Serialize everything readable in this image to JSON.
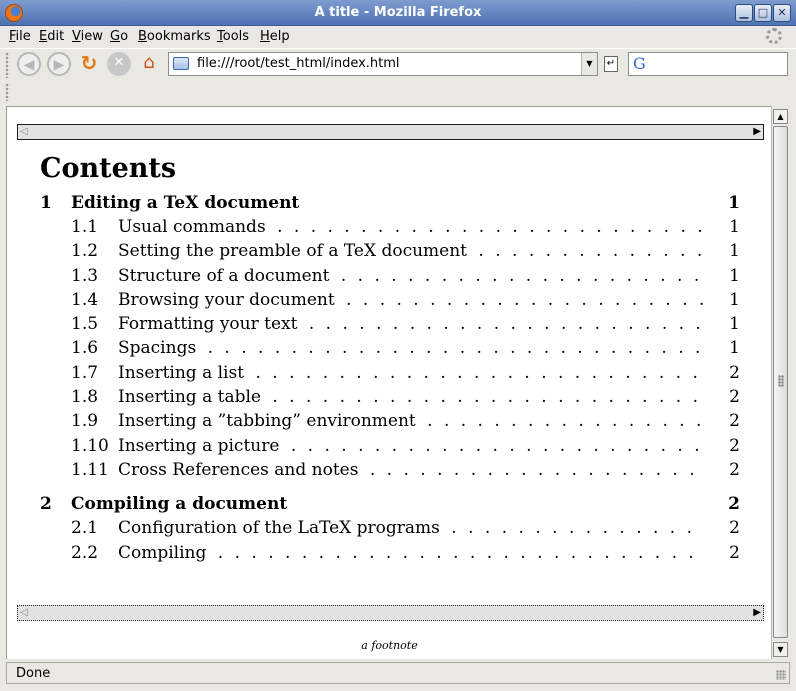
{
  "window": {
    "title": "A title - Mozilla Firefox"
  },
  "menu": {
    "items": [
      {
        "u": "F",
        "rest": "ile"
      },
      {
        "u": "E",
        "rest": "dit"
      },
      {
        "u": "V",
        "rest": "iew"
      },
      {
        "u": "G",
        "rest": "o"
      },
      {
        "u": "B",
        "rest": "ookmarks"
      },
      {
        "u": "T",
        "rest": "ools"
      },
      {
        "u": "H",
        "rest": "elp"
      }
    ]
  },
  "navigation": {
    "url": "file:///root/test_html/index.html",
    "search_engine_glyph": "G"
  },
  "document": {
    "heading": "Contents",
    "sections": [
      {
        "num": "1",
        "title": "Editing a TeX document",
        "page": "1",
        "subsections": [
          {
            "num": "1.1",
            "title": "Usual commands",
            "page": "1"
          },
          {
            "num": "1.2",
            "title": "Setting the preamble of a TeX document",
            "page": "1"
          },
          {
            "num": "1.3",
            "title": "Structure of a document",
            "page": "1"
          },
          {
            "num": "1.4",
            "title": "Browsing your document",
            "page": "1"
          },
          {
            "num": "1.5",
            "title": "Formatting your text",
            "page": "1"
          },
          {
            "num": "1.6",
            "title": "Spacings",
            "page": "1"
          },
          {
            "num": "1.7",
            "title": "Inserting a list",
            "page": "2"
          },
          {
            "num": "1.8",
            "title": "Inserting a table",
            "page": "2"
          },
          {
            "num": "1.9",
            "title": "Inserting a ”tabbing” environment",
            "page": "2"
          },
          {
            "num": "1.10",
            "title": "Inserting a picture",
            "page": "2"
          },
          {
            "num": "1.11",
            "title": "Cross References and notes",
            "page": "2"
          }
        ]
      },
      {
        "num": "2",
        "title": "Compiling a document",
        "page": "2",
        "subsections": [
          {
            "num": "2.1",
            "title": "Configuration of the LaTeX programs",
            "page": "2"
          },
          {
            "num": "2.2",
            "title": "Compiling",
            "page": "2"
          }
        ]
      }
    ],
    "footnote": "a footnote"
  },
  "status": {
    "text": "Done"
  },
  "colors": {
    "titlebar": "#5a7dbd",
    "chrome": "#eae8e3",
    "page": "#ffffff"
  },
  "icons": [
    "firefox-icon",
    "minimize-icon",
    "maximize-icon",
    "close-icon",
    "back-icon",
    "forward-icon",
    "reload-icon",
    "stop-icon",
    "home-icon",
    "page-icon",
    "go-icon",
    "search-engine-icon"
  ]
}
